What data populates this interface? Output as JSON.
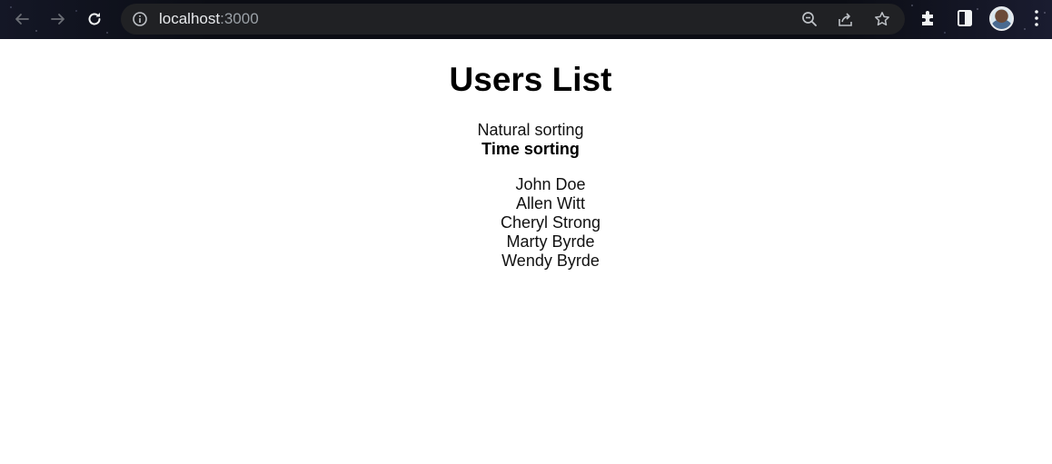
{
  "browser": {
    "url_host": "localhost",
    "url_port": ":3000"
  },
  "page": {
    "title": "Users List",
    "sort_options": {
      "natural": "Natural sorting",
      "time": "Time sorting"
    },
    "users": [
      "John Doe",
      "Allen Witt",
      "Cheryl Strong",
      "Marty Byrde",
      "Wendy Byrde"
    ]
  }
}
